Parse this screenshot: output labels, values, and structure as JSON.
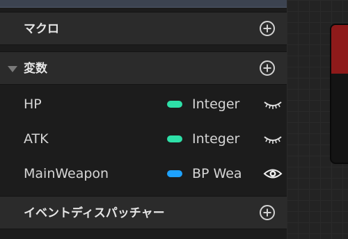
{
  "sections": {
    "macros": {
      "label": "マクロ"
    },
    "variables": {
      "label": "変数",
      "items": [
        {
          "name": "HP",
          "type": "Integer",
          "type_color": "#2ee0a8",
          "visibility_icon": "eye-closed-icon"
        },
        {
          "name": "ATK",
          "type": "Integer",
          "type_color": "#2ee0a8",
          "visibility_icon": "eye-closed-icon"
        },
        {
          "name": "MainWeapon",
          "type": "BP Wea",
          "type_color": "#1ea2ff",
          "visibility_icon": "eye-open-icon"
        }
      ]
    },
    "event_dispatchers": {
      "label": "イベントディスパッチャー"
    }
  }
}
